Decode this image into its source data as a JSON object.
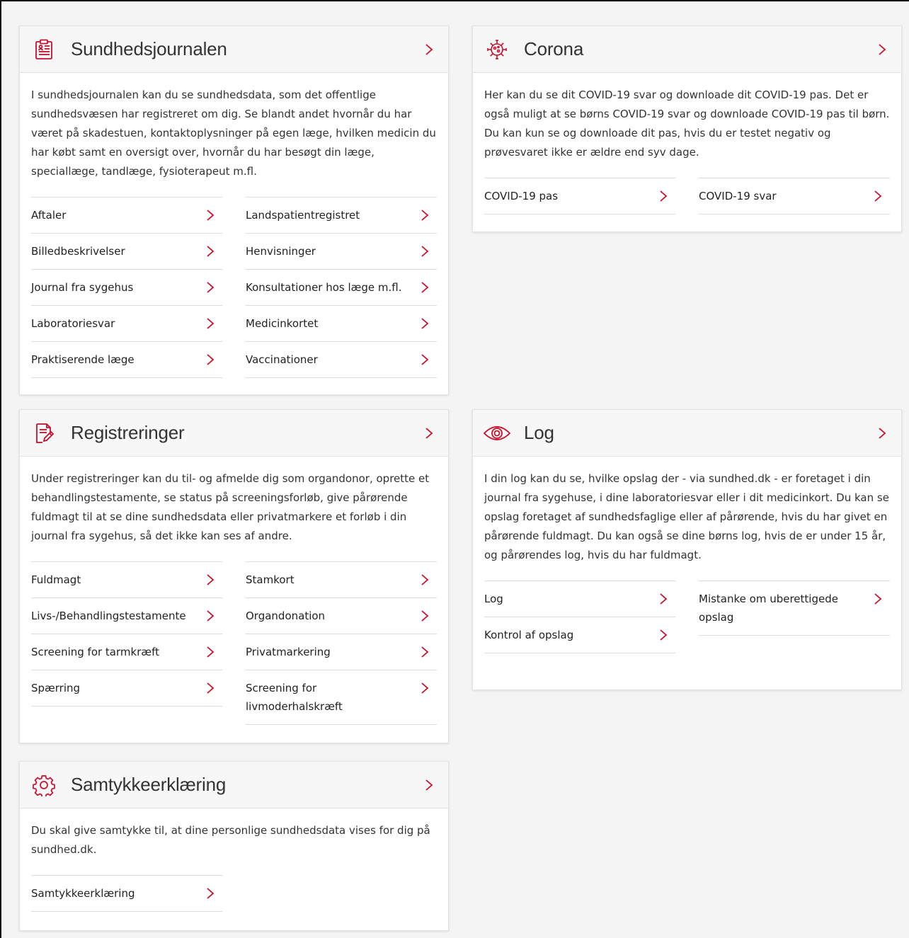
{
  "accent_color": "#c8102e",
  "cards": {
    "sundhedsjournalen": {
      "title": "Sundhedsjournalen",
      "icon": "medical-record-icon",
      "description": "I sundhedsjournalen kan du se sundhedsdata, som det offentlige sundhedsvæsen har registreret om dig. Se blandt andet hvornår du har været på skadestuen, kontaktoplysninger på egen læge, hvilken medicin du har købt samt en oversigt over, hvornår du har besøgt din læge, speciallæge, tandlæge, fysioterapeut m.fl.",
      "left_links": [
        "Aftaler",
        "Billedbeskrivelser",
        "Journal fra sygehus",
        "Laboratoriesvar",
        "Praktiserende læge"
      ],
      "right_links": [
        "Landspatientregistret",
        "Henvisninger",
        "Konsultationer hos læge m.fl.",
        "Medicinkortet",
        "Vaccinationer"
      ]
    },
    "corona": {
      "title": "Corona",
      "icon": "virus-icon",
      "description": "Her kan du se dit COVID-19 svar og downloade dit COVID-19 pas. Det er også muligt at se børns COVID-19 svar og downloade COVID-19 pas til børn. Du kan kun se og downloade dit pas, hvis du er testet negativ og prøvesvaret ikke er ældre end syv dage.",
      "left_links": [
        "COVID-19 pas"
      ],
      "right_links": [
        "COVID-19 svar"
      ]
    },
    "registreringer": {
      "title": "Registreringer",
      "icon": "document-pen-icon",
      "description": "Under registreringer kan du til- og afmelde dig som organdonor, oprette et behandlingstestamente, se status på screeningsforløb, give pårørende fuldmagt til at se dine sundhedsdata eller privatmarkere et forløb i din journal fra sygehus, så det ikke kan ses af andre.",
      "left_links": [
        "Fuldmagt",
        "Livs-/Behandlingstestamente",
        "Screening for tarmkræft",
        "Spærring"
      ],
      "right_links": [
        "Stamkort",
        "Organdonation",
        "Privatmarkering",
        "Screening for livmoderhalskræft"
      ]
    },
    "log": {
      "title": "Log",
      "icon": "eye-icon",
      "description": "I din log kan du se, hvilke opslag der - via sundhed.dk - er foretaget i din journal fra sygehuse, i dine laboratoriesvar eller i dit medicinkort. Du kan se opslag foretaget af sundhedsfaglige eller af pårørende, hvis du har givet en pårørende fuldmagt. Du kan også se dine børns log, hvis de er under 15 år, og pårørendes log, hvis du har fuldmagt.",
      "left_links": [
        "Log",
        "Kontrol af opslag"
      ],
      "right_links": [
        "Mistanke om uberettigede opslag"
      ]
    },
    "samtykke": {
      "title": "Samtykkeerklæring",
      "icon": "gear-icon",
      "description": "Du skal give samtykke til, at dine personlige sundhedsdata vises for dig på sundhed.dk.",
      "left_links": [
        "Samtykkeerklæring"
      ],
      "right_links": []
    }
  }
}
